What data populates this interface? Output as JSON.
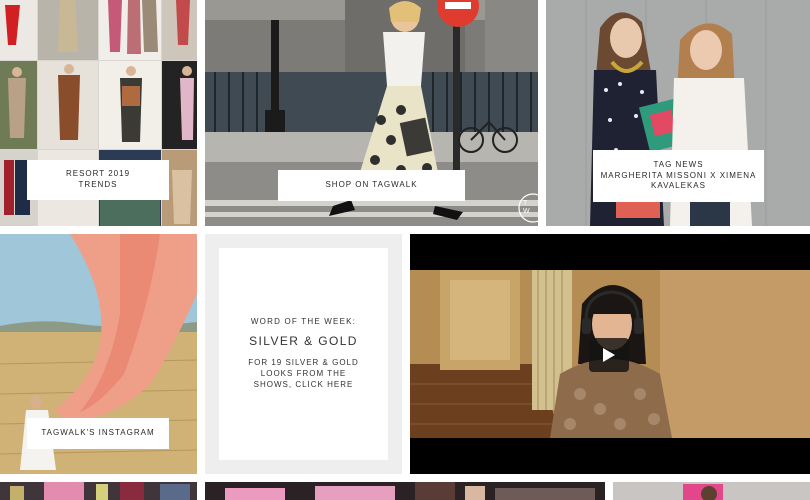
{
  "tiles": {
    "resort": {
      "lines": [
        "RESORT 2019",
        "TRENDS"
      ]
    },
    "street": {
      "label": "SHOP ON TAGWALK",
      "corner_mark": "T W"
    },
    "duo": {
      "lines": [
        "TAG NEWS",
        "MARGHERITA MISSONI X XIMENA",
        "KAVALEKAS"
      ]
    },
    "instagram": {
      "label": "TAGWALK'S INSTAGRAM"
    },
    "word": {
      "kicker": "WORD OF THE WEEK:",
      "title": "SILVER & GOLD",
      "body": "FOR 19 SILVER & GOLD LOOKS FROM THE SHOWS, CLICK HERE"
    },
    "video": {
      "play_icon": "play-icon"
    }
  },
  "colors": {
    "card_background": "#ffffff",
    "video_background": "#000000",
    "no_entry_sign": "#e03b2f"
  }
}
